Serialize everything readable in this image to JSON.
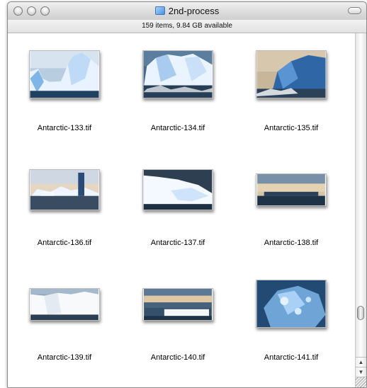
{
  "window": {
    "title": "2nd-process",
    "status": "159 items, 9.84 GB available"
  },
  "files": [
    {
      "name": "Antarctic-133.tif"
    },
    {
      "name": "Antarctic-134.tif"
    },
    {
      "name": "Antarctic-135.tif"
    },
    {
      "name": "Antarctic-136.tif"
    },
    {
      "name": "Antarctic-137.tif"
    },
    {
      "name": "Antarctic-138.tif"
    },
    {
      "name": "Antarctic-139.tif"
    },
    {
      "name": "Antarctic-140.tif"
    },
    {
      "name": "Antarctic-141.tif"
    }
  ],
  "scrollbar": {
    "up_arrow_icon": "▲",
    "down_arrow_icon": "▼"
  },
  "colors": {
    "ice": "#dcecff",
    "sea": "#1c3650",
    "sky": "#c9d8e6"
  }
}
